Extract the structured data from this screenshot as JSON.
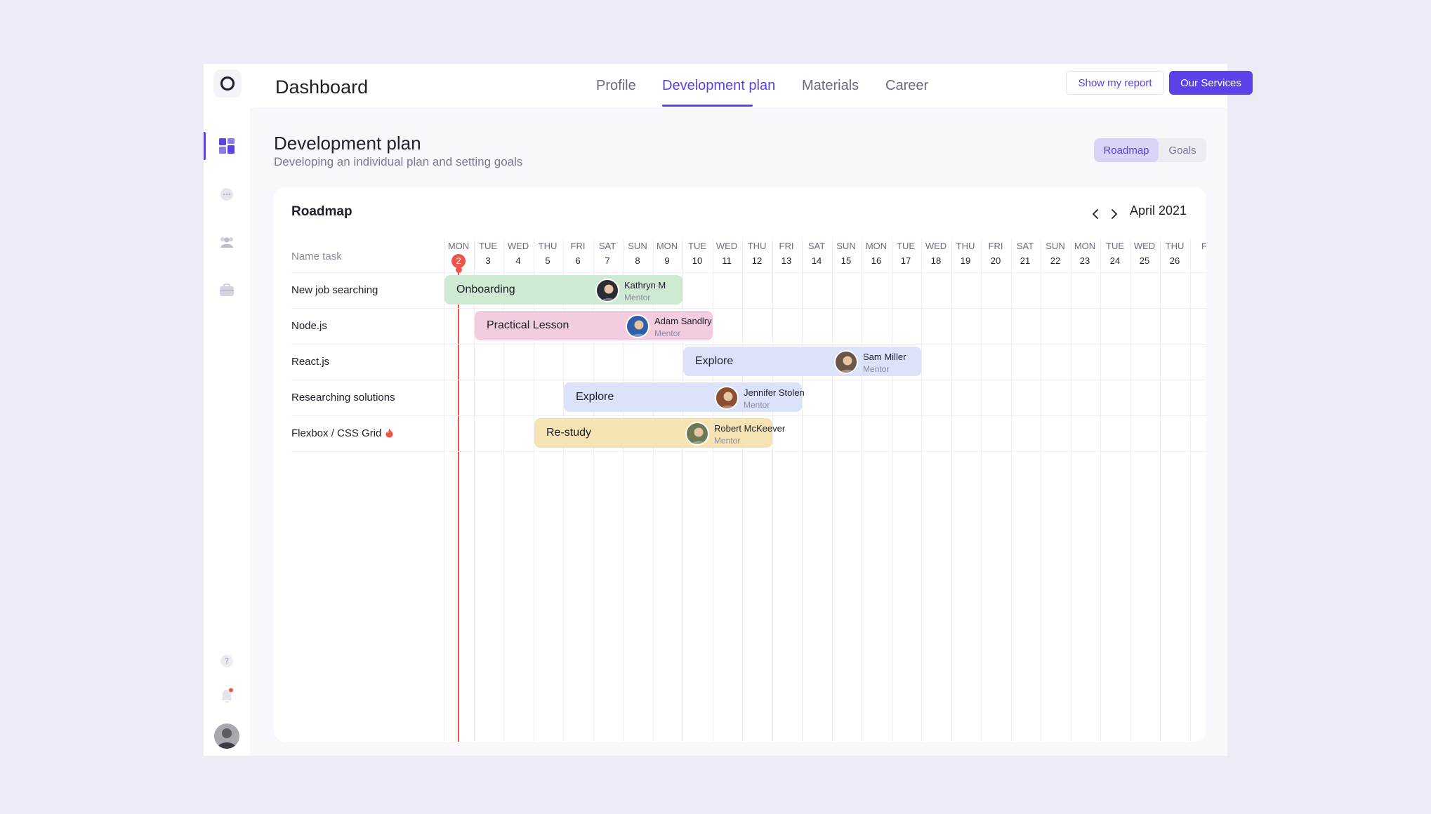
{
  "nav": {
    "brand": "Dashboard",
    "tabs": [
      {
        "label": "Profile"
      },
      {
        "label": "Development plan"
      },
      {
        "label": "Materials"
      },
      {
        "label": "Career"
      }
    ],
    "active_tab": "Development plan",
    "show_report_label": "Show my report",
    "services_label": "Our Services"
  },
  "page": {
    "title": "Development plan",
    "subtitle": "Developing an individual plan and setting goals"
  },
  "view_toggle": {
    "roadmap": "Roadmap",
    "goals": "Goals",
    "active": "Roadmap"
  },
  "roadmap": {
    "title": "Roadmap",
    "month": "April 2021",
    "name_header": "Name task",
    "days": [
      {
        "dow": "MON",
        "num": "2"
      },
      {
        "dow": "TUE",
        "num": "3"
      },
      {
        "dow": "WED",
        "num": "4"
      },
      {
        "dow": "THU",
        "num": "5"
      },
      {
        "dow": "FRI",
        "num": "6"
      },
      {
        "dow": "SAT",
        "num": "7"
      },
      {
        "dow": "SUN",
        "num": "8"
      },
      {
        "dow": "MON",
        "num": "9"
      },
      {
        "dow": "TUE",
        "num": "10"
      },
      {
        "dow": "WED",
        "num": "11"
      },
      {
        "dow": "THU",
        "num": "12"
      },
      {
        "dow": "FRI",
        "num": "13"
      },
      {
        "dow": "SAT",
        "num": "14"
      },
      {
        "dow": "SUN",
        "num": "15"
      },
      {
        "dow": "MON",
        "num": "16"
      },
      {
        "dow": "TUE",
        "num": "17"
      },
      {
        "dow": "WED",
        "num": "18"
      },
      {
        "dow": "THU",
        "num": "19"
      },
      {
        "dow": "FRI",
        "num": "20"
      },
      {
        "dow": "SAT",
        "num": "21"
      },
      {
        "dow": "SUN",
        "num": "22"
      },
      {
        "dow": "MON",
        "num": "23"
      },
      {
        "dow": "TUE",
        "num": "24"
      },
      {
        "dow": "WED",
        "num": "25"
      },
      {
        "dow": "THU",
        "num": "26"
      },
      {
        "dow": "F",
        "num": ""
      }
    ],
    "today_index": 0,
    "tasks": [
      {
        "name": "New job searching",
        "bar_label": "Onboarding",
        "mentor": "Kathryn M",
        "role": "Mentor",
        "start": 0,
        "span": 8,
        "color": "#CFEAD2",
        "avatar_color": "#2B2B33"
      },
      {
        "name": "Node.js",
        "bar_label": "Practical Lesson",
        "mentor": "Adam Sandlry",
        "role": "Mentor",
        "start": 1,
        "span": 8,
        "color": "#F2CDE0",
        "avatar_color": "#2F5FA8"
      },
      {
        "name": "React.js",
        "bar_label": "Explore",
        "mentor": "Sam Miller",
        "role": "Mentor",
        "start": 8,
        "span": 8,
        "color": "#DBE2FA",
        "avatar_color": "#6B5448"
      },
      {
        "name": "Researching solutions",
        "bar_label": "Explore",
        "mentor": "Jennifer Stolen",
        "role": "Mentor",
        "start": 4,
        "span": 8,
        "color": "#DBE2FA",
        "avatar_color": "#8A4E32"
      },
      {
        "name": "Flexbox / CSS Grid",
        "bar_label": "Re-study",
        "mentor": "Robert McKeever",
        "role": "Mentor",
        "start": 3,
        "span": 8,
        "color": "#F6E3B4",
        "avatar_color": "#6E7A54",
        "hot": true
      }
    ]
  },
  "colors": {
    "accent": "#5B42E8",
    "today": "#F0534E"
  },
  "icons": {
    "logo": "logo-ring-icon",
    "sidebar": [
      "dashboard-grid-icon",
      "chat-icon",
      "team-icon",
      "briefcase-icon"
    ],
    "bottom": [
      "help-icon",
      "bell-icon"
    ],
    "task_flag": "fire-icon"
  }
}
